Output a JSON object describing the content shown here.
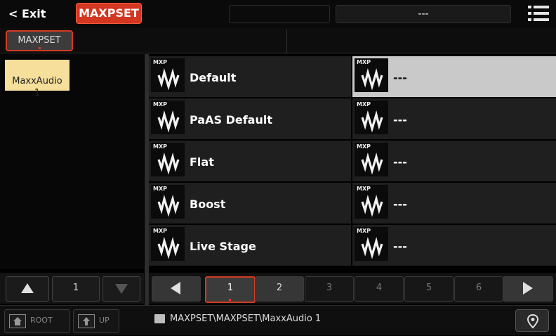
{
  "header": {
    "exit_label": "< Exit",
    "mode_label": "MAXPSET",
    "title_left": "",
    "title_right": "---"
  },
  "tabs": [
    {
      "label": "MAXPSET",
      "active": true
    }
  ],
  "folders": [
    {
      "label": "MaxxAudio\n1",
      "selected": true
    }
  ],
  "items": [
    {
      "badge": "MXP",
      "name": "Default",
      "selected": false
    },
    {
      "badge": "MXP",
      "name": "---",
      "selected": true
    },
    {
      "badge": "MXP",
      "name": "PaAS Default",
      "selected": false
    },
    {
      "badge": "MXP",
      "name": "---",
      "selected": false
    },
    {
      "badge": "MXP",
      "name": "Flat",
      "selected": false
    },
    {
      "badge": "MXP",
      "name": "---",
      "selected": false
    },
    {
      "badge": "MXP",
      "name": "Boost",
      "selected": false
    },
    {
      "badge": "MXP",
      "name": "---",
      "selected": false
    },
    {
      "badge": "MXP",
      "name": "Live Stage",
      "selected": false
    },
    {
      "badge": "MXP",
      "name": "---",
      "selected": false
    }
  ],
  "folder_nav": {
    "page": "1"
  },
  "pages": [
    "1",
    "2",
    "3",
    "4",
    "5",
    "6"
  ],
  "current_page": "1",
  "bottom": {
    "root_label": "ROOT",
    "up_label": "UP",
    "path": "MAXPSET\\MAXPSET\\MaxxAudio 1"
  },
  "icons": {
    "menu": "menu-list-icon",
    "preset": "waves-logo-icon",
    "folder": "folder-icon",
    "pin": "location-pin-icon",
    "home": "home-folder-icon",
    "up": "up-folder-icon"
  },
  "colors": {
    "accent": "#d33722",
    "selected_folder": "#f5df9a",
    "selected_item": "#c9c9c9"
  }
}
